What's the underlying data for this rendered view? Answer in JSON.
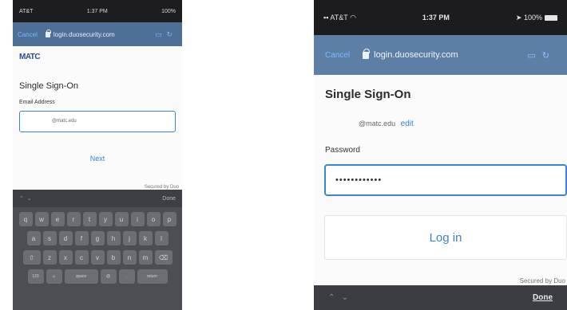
{
  "phone1": {
    "status": {
      "carrier": "AT&T",
      "time": "1:37 PM",
      "battery": "100%"
    },
    "urlbar": {
      "cancel": "Cancel",
      "url": "login.duosecurity.com"
    },
    "logo": "MATC",
    "title": "Single Sign-On",
    "email_label": "Email Address",
    "email_value": "@matc.edu",
    "next_label": "Next",
    "secured_by": "Secured by Duo",
    "toolbar": {
      "done": "Done"
    },
    "keyboard": {
      "row1": [
        "q",
        "w",
        "e",
        "r",
        "t",
        "y",
        "u",
        "i",
        "o",
        "p"
      ],
      "row2": [
        "a",
        "s",
        "d",
        "f",
        "g",
        "h",
        "j",
        "k",
        "l"
      ],
      "row3": [
        "⇧",
        "z",
        "x",
        "c",
        "v",
        "b",
        "n",
        "m",
        "⌫"
      ],
      "row4": [
        "123",
        "☺",
        "space",
        "@",
        ".",
        "return"
      ]
    }
  },
  "phone2": {
    "status": {
      "carrier": "AT&T",
      "time": "1:37 PM",
      "battery": "100%"
    },
    "urlbar": {
      "cancel": "Cancel",
      "url": "login.duosecurity.com"
    },
    "title": "Single Sign-On",
    "email": "@matc.edu",
    "edit_label": "edit",
    "password_label": "Password",
    "password_value": "••••••••••••",
    "login_label": "Log in",
    "secured_by": "Secured by Duo",
    "toolbar": {
      "done": "Done"
    }
  }
}
